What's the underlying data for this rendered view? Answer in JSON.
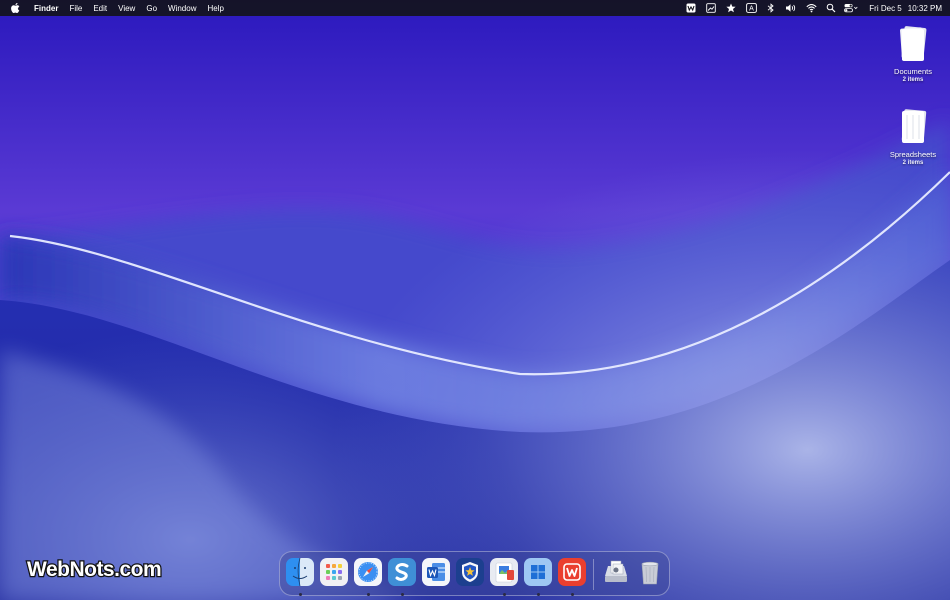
{
  "menubar": {
    "app_name": "Finder",
    "menus": [
      "File",
      "Edit",
      "View",
      "Go",
      "Window",
      "Help"
    ],
    "status_icons": [
      "word-icon",
      "image-capture-icon",
      "star-icon",
      "input-source-icon",
      "bluetooth-icon",
      "volume-icon",
      "wifi-icon",
      "spotlight-search-icon",
      "control-center-icon"
    ],
    "input_source_letter": "A",
    "date": "Fri Dec 5",
    "time": "10:32 PM"
  },
  "desktop": {
    "items": [
      {
        "name": "Documents",
        "count": "2 items"
      },
      {
        "name": "Spreadsheets",
        "count": "2 items"
      }
    ]
  },
  "watermark": "WebNots.com",
  "dock": {
    "apps": [
      "finder-icon",
      "launchpad-icon",
      "safari-icon",
      "scrivener-icon",
      "microsoft-word-icon",
      "security-shield-icon",
      "preview-icon",
      "windows-app-icon",
      "wps-office-icon"
    ],
    "running_indicators": [
      true,
      false,
      true,
      true,
      false,
      false,
      true,
      true,
      true
    ],
    "utilities": [
      "file-drop-icon",
      "trash-icon"
    ]
  },
  "colors": {
    "menubar": "#15151d",
    "wallpaper_top": "#2e1fc0",
    "wallpaper_wave": "#5a63d8",
    "dock_accent": "#2a2a44"
  }
}
